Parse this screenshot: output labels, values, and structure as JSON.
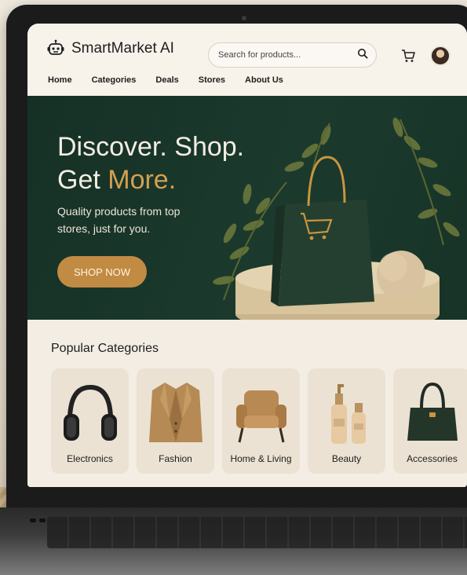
{
  "brand": {
    "name": "SmartMarket AI",
    "icon": "robot-icon"
  },
  "search": {
    "placeholder": "Search for products...",
    "icon": "search-icon"
  },
  "header_icons": {
    "cart": "cart-icon",
    "account": "avatar"
  },
  "nav": {
    "items": [
      {
        "label": "Home"
      },
      {
        "label": "Categories"
      },
      {
        "label": "Deals"
      },
      {
        "label": "Stores"
      },
      {
        "label": "About Us"
      }
    ]
  },
  "hero": {
    "line1": "Discover. Shop.",
    "line2_prefix": "Get ",
    "line2_accent": "More.",
    "subtitle": "Quality products from top stores, just for you.",
    "cta": "SHOP NOW"
  },
  "categories": {
    "title": "Popular Categories",
    "items": [
      {
        "label": "Electronics",
        "icon": "headphones-icon"
      },
      {
        "label": "Fashion",
        "icon": "blazer-icon"
      },
      {
        "label": "Home & Living",
        "icon": "armchair-icon"
      },
      {
        "label": "Beauty",
        "icon": "cosmetics-icon"
      },
      {
        "label": "Accessories",
        "icon": "handbag-icon"
      }
    ]
  },
  "colors": {
    "hero_bg": "#1b3a2d",
    "accent": "#d4a04f",
    "cta_bg": "#c18b43",
    "page_bg": "#f6f1e8"
  }
}
